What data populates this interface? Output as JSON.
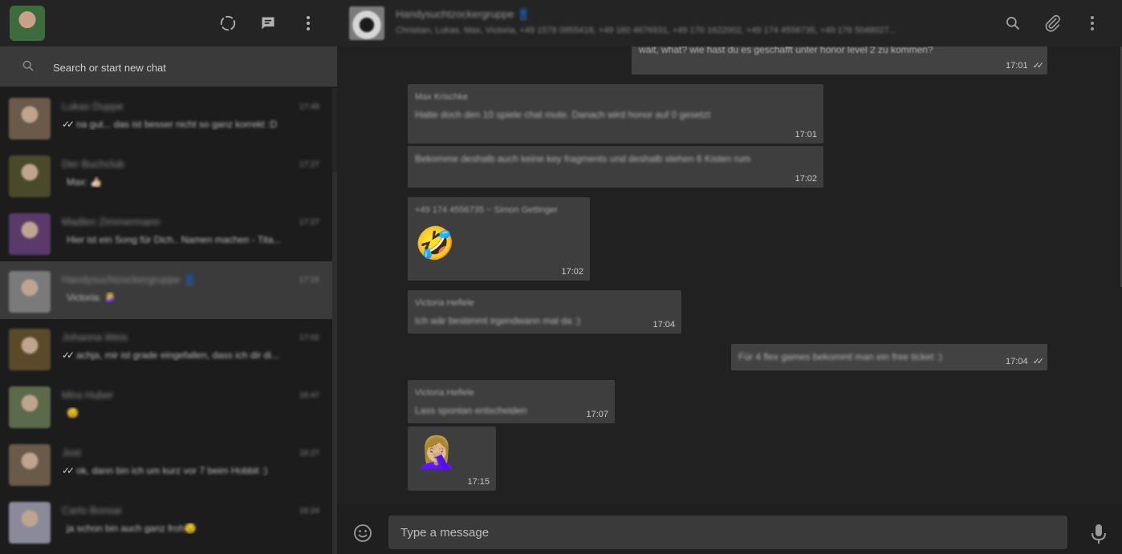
{
  "sidebar": {
    "search_placeholder": "Search or start new chat",
    "chats": [
      {
        "name": "Lukas Duppe",
        "time": "17:49",
        "ticks": "✓✓",
        "preview": "na gut... das ist besser nicht so ganz korrekt :D",
        "avatar_color": "#6b5a4a"
      },
      {
        "name": "Der Buchclub",
        "time": "17:27",
        "ticks": "",
        "preview": "Max: 👍🏻",
        "avatar_color": "#4a4a2a"
      },
      {
        "name": "Madlen Zimmermann",
        "time": "17:27",
        "ticks": "",
        "preview": "Hier ist ein Song für Dich.. Namen machen - Tita...",
        "avatar_color": "#5a3a6a"
      },
      {
        "name": "Handysuchtzockergruppe 👖",
        "time": "17:15",
        "ticks": "",
        "preview": "Victoria: 🤦🏼‍♀️",
        "avatar_color": "#7a7a7a"
      },
      {
        "name": "Johanna Weis",
        "time": "17:02",
        "ticks": "✓✓",
        "preview": "achja, mir ist grade eingefallen, dass ich dir di...",
        "avatar_color": "#5a4a2a"
      },
      {
        "name": "Mira Huber",
        "time": "16:47",
        "ticks": "",
        "preview": "😉",
        "avatar_color": "#5a6a4a"
      },
      {
        "name": "Jost",
        "time": "16:27",
        "ticks": "✓✓",
        "preview": "ok, dann bin ich um kurz vor 7 beim Hobbit :)",
        "avatar_color": "#6a5a4a"
      },
      {
        "name": "Carlo Bonsai",
        "time": "16:24",
        "ticks": "",
        "preview": "ja schon bin auch ganz froh😉",
        "avatar_color": "#8a8a9a"
      }
    ]
  },
  "header": {
    "group_name": "Handysuchtzockergruppe 👖",
    "members": "Christian, Lukas, Max, Victoria, +49 1578 0955418, +49 160 4676931, +49 170 1622002, +49 174 4556735, +49 176 5048027..."
  },
  "messages": [
    {
      "sender": "",
      "text": "wait, what? wie hast du es geschafft unter honor level 2 zu kommen?",
      "time": "17:01",
      "ticks": "✓✓"
    },
    {
      "sender": "Max Krischke",
      "text": "Hatte doch den 10 spiele chat mute. Danach wird honor auf 0 gesetzt",
      "time": "17:01",
      "ticks": ""
    },
    {
      "sender": "",
      "text": "Bekomme deshalb auch keine key fragments und deshalb stehen 6 Kisten rum",
      "time": "17:02",
      "ticks": ""
    },
    {
      "sender": "+49 174 4556735 ~ Simon Gettinger",
      "text": "🤣",
      "time": "17:02",
      "ticks": ""
    },
    {
      "sender": "Victoria Heflele",
      "text": "Ich wär bestimmt irgendwann mal da :)",
      "time": "17:04",
      "ticks": ""
    },
    {
      "sender": "",
      "text": "Für 4 flex games bekommt man ein free ticket :)",
      "time": "17:04",
      "ticks": "✓✓"
    },
    {
      "sender": "Victoria Heflele",
      "text": "Lass spontan entscheiden",
      "time": "17:07",
      "ticks": ""
    },
    {
      "sender": "",
      "text": "🤦🏼‍♀️",
      "time": "17:15",
      "ticks": ""
    }
  ],
  "composer": {
    "placeholder": "Type a message"
  }
}
